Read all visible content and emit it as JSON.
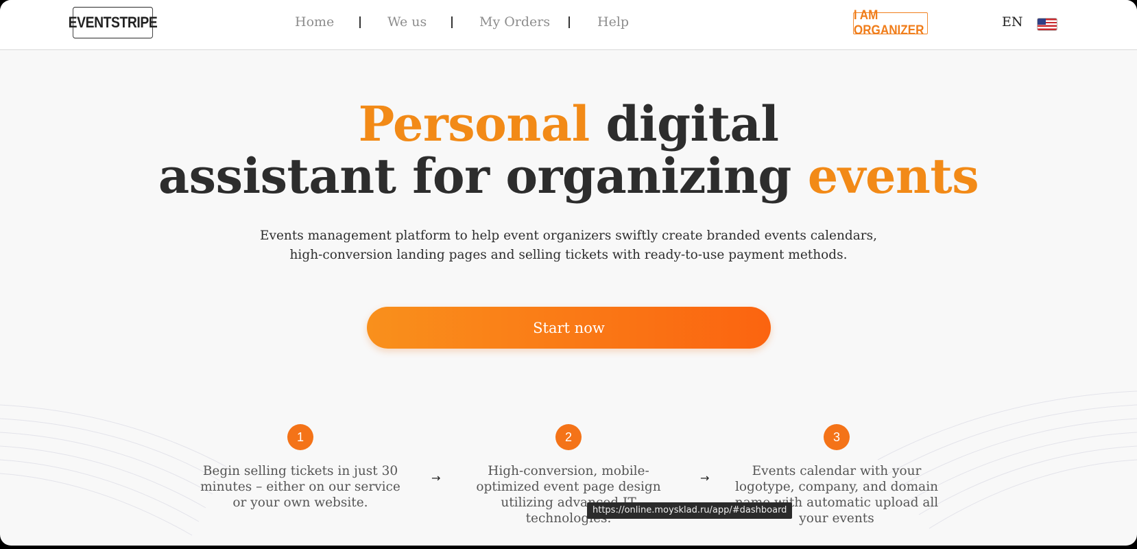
{
  "header": {
    "logo": "EVENTSTRIPE",
    "nav": [
      "Home",
      "We us",
      "My Orders",
      "Help"
    ],
    "organizer_button": "I AM ORGANIZER",
    "language": "EN",
    "flag_icon": "us-flag-icon"
  },
  "hero": {
    "title_word_1": "Personal",
    "title_rest_1": " digital",
    "title_line_2": "assistant for organizing ",
    "title_word_2": "events",
    "subtitle_line_1": "Events management platform to help event organizers swiftly create branded events calendars,",
    "subtitle_line_2": "high-conversion landing pages and selling tickets with ready-to-use payment methods.",
    "cta_label": "Start now"
  },
  "steps": [
    {
      "number": "1",
      "text": "Begin selling tickets in just 30 minutes – either on our service or your own website."
    },
    {
      "number": "2",
      "text": "High-conversion, mobile-optimized event page design utilizing advanced IT technologies."
    },
    {
      "number": "3",
      "text": "Events calendar with your logotype, company, and domain name with automatic upload all your events"
    }
  ],
  "step_arrow": "→",
  "tooltip": "https://online.moysklad.ru/app/#dashboard",
  "colors": {
    "accent": "#f28a17",
    "cta_start": "#f9901c",
    "cta_end": "#fb6410",
    "text_dark": "#2d2d2d"
  }
}
